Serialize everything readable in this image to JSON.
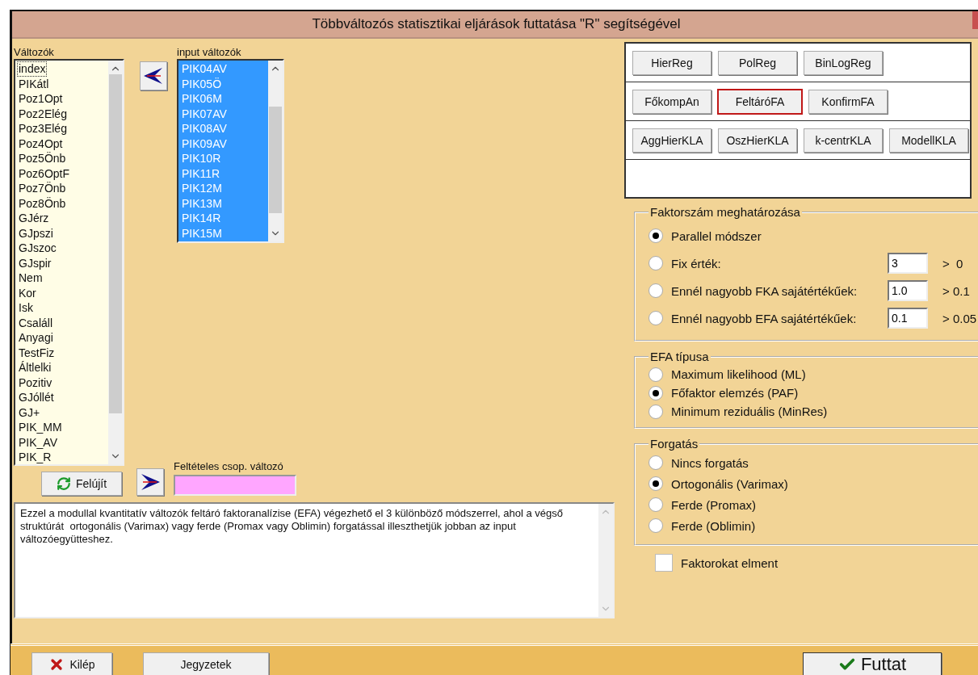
{
  "window": {
    "title": "Többváltozós statisztikai eljárások futtatása \"R\" segítségével"
  },
  "variables": {
    "label": "Változók",
    "items": [
      {
        "text": "index",
        "focused": true
      },
      {
        "text": "PIKátl",
        "focused": false
      },
      {
        "text": "Poz1Opt",
        "focused": false
      },
      {
        "text": "Poz2Elég",
        "focused": false
      },
      {
        "text": "Poz3Elég",
        "focused": false
      },
      {
        "text": "Poz4Opt",
        "focused": false
      },
      {
        "text": "Poz5Önb",
        "focused": false
      },
      {
        "text": "Poz6OptF",
        "focused": false
      },
      {
        "text": "Poz7Önb",
        "focused": false
      },
      {
        "text": "Poz8Önb",
        "focused": false
      },
      {
        "text": "GJérz",
        "focused": false
      },
      {
        "text": "GJpszi",
        "focused": false
      },
      {
        "text": "GJszoc",
        "focused": false
      },
      {
        "text": "GJspir",
        "focused": false
      },
      {
        "text": "Nem",
        "focused": false
      },
      {
        "text": "Kor",
        "focused": false
      },
      {
        "text": "Isk",
        "focused": false
      },
      {
        "text": "Csaláll",
        "focused": false
      },
      {
        "text": "Anyagi",
        "focused": false
      },
      {
        "text": "TestFiz",
        "focused": false
      },
      {
        "text": "Áltlelki",
        "focused": false
      },
      {
        "text": "Pozitiv",
        "focused": false
      },
      {
        "text": "GJóllét",
        "focused": false
      },
      {
        "text": "GJ+",
        "focused": false
      },
      {
        "text": "PIK_MM",
        "focused": false
      },
      {
        "text": "PIK_AV",
        "focused": false
      },
      {
        "text": "PIK_R",
        "focused": false
      }
    ]
  },
  "input_variables": {
    "label": "input változók",
    "items": [
      {
        "text": "PIK04AV",
        "selected": true
      },
      {
        "text": "PIK05Ö",
        "selected": true
      },
      {
        "text": "PIK06M",
        "selected": true
      },
      {
        "text": "PIK07AV",
        "selected": true
      },
      {
        "text": "PIK08AV",
        "selected": true
      },
      {
        "text": "PIK09AV",
        "selected": true
      },
      {
        "text": "PIK10R",
        "selected": true
      },
      {
        "text": "PIK11R",
        "selected": true
      },
      {
        "text": "PIK12M",
        "selected": true
      },
      {
        "text": "PIK13M",
        "selected": true
      },
      {
        "text": "PIK14R",
        "selected": true
      },
      {
        "text": "PIK15M",
        "selected": true
      }
    ]
  },
  "refresh_button": {
    "label": "Felújít"
  },
  "condition_field": {
    "label": "Feltételes csop. változó"
  },
  "description": "Ezzel a modullal kvantitatív változók feltáró faktoranalízise (EFA) végezhető el 3 különböző módszerrel, ahol a végső struktúrát  ortogonális (Varimax) vagy ferde (Promax vagy Oblimin) forgatással illeszthetjük jobban az input változóegyütteshez.",
  "method_rows": [
    [
      {
        "label": "HierReg",
        "selected": false
      },
      {
        "label": "PolReg",
        "selected": false
      },
      {
        "label": "BinLogReg",
        "selected": false
      }
    ],
    [
      {
        "label": "FőkompAn",
        "selected": false
      },
      {
        "label": "FeltáróFA",
        "selected": true
      },
      {
        "label": "KonfirmFA",
        "selected": false
      }
    ],
    [
      {
        "label": "AggHierKLA",
        "selected": false
      },
      {
        "label": "OszHierKLA",
        "selected": false
      },
      {
        "label": "k-centrKLA",
        "selected": false
      },
      {
        "label": "ModellKLA",
        "selected": false
      }
    ]
  ],
  "factor_count": {
    "title": "Faktorszám meghatározása",
    "options": [
      {
        "label": "Parallel módszer",
        "selected": true
      },
      {
        "label": "Fix érték:",
        "selected": false,
        "value": "3",
        "limit": ">  0"
      },
      {
        "label": "Ennél nagyobb FKA sajátértékűek:",
        "selected": false,
        "value": "1.0",
        "limit": "> 0.1"
      },
      {
        "label": "Ennél nagyobb EFA sajátértékűek:",
        "selected": false,
        "value": "0.1",
        "limit": "> 0.05"
      }
    ]
  },
  "efa_type": {
    "title": "EFA típusa",
    "options": [
      {
        "label": "Maximum likelihood (ML)",
        "selected": false
      },
      {
        "label": "Főfaktor elemzés (PAF)",
        "selected": true
      },
      {
        "label": "Minimum reziduális (MinRes)",
        "selected": false
      }
    ]
  },
  "rotation": {
    "title": "Forgatás",
    "options": [
      {
        "label": "Nincs forgatás",
        "selected": false
      },
      {
        "label": "Ortogonális (Varimax)",
        "selected": true
      },
      {
        "label": "Ferde (Promax)",
        "selected": false
      },
      {
        "label": "Ferde (Oblimin)",
        "selected": false
      }
    ]
  },
  "save_factors": {
    "label": "Faktorokat elment",
    "checked": false
  },
  "footer_buttons": [
    {
      "kind": "exit",
      "label": "Kilép"
    },
    {
      "kind": "notes",
      "label": "Jegyzetek"
    },
    {
      "kind": "run",
      "label": "Futtat"
    }
  ]
}
